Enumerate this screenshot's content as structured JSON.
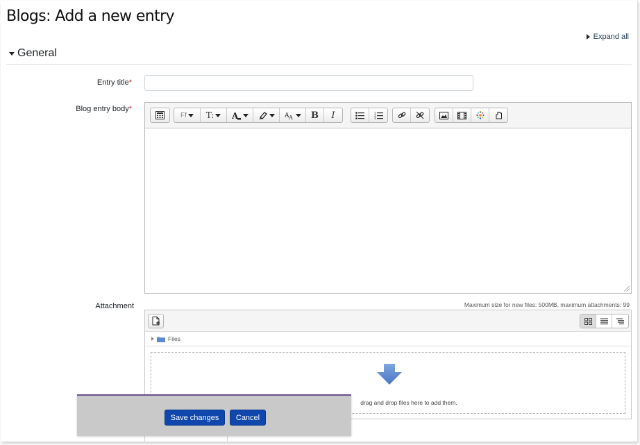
{
  "page": {
    "title": "Blogs: Add a new entry",
    "expand_all": "Expand all"
  },
  "section": {
    "title": "General"
  },
  "form": {
    "entry_title": {
      "label": "Entry title",
      "required_mark": "*",
      "value": ""
    },
    "body": {
      "label": "Blog entry body",
      "required_mark": "*",
      "value": ""
    },
    "attachment": {
      "label": "Attachment",
      "max_info": "Maximum size for new files: 500MB, maximum attachments: 99",
      "path_root": "Files",
      "drop_hint": "drag and drop files here to add them."
    }
  },
  "editor_toolbar": [
    {
      "group": "collapse",
      "items": [
        "show-more-buttons-icon"
      ]
    },
    {
      "group": "style",
      "items": [
        "font-family",
        "font-size",
        "font-color",
        "background-color",
        "text-direction",
        "bold",
        "italic"
      ]
    },
    {
      "group": "list",
      "items": [
        "unordered-list",
        "ordered-list"
      ]
    },
    {
      "group": "links",
      "items": [
        "link",
        "unlink"
      ]
    },
    {
      "group": "files",
      "items": [
        "image",
        "media",
        "h5p",
        "manage-files"
      ]
    }
  ],
  "editor_labels": {
    "font_family": "Ff",
    "font_size": "T:",
    "bold": "B",
    "italic": "I"
  },
  "buttons": {
    "save": "Save changes",
    "cancel": "Cancel"
  },
  "colors": {
    "primary": "#0f47ad",
    "required": "#c41e24",
    "footer_bar": "#c9c9c9",
    "drop_arrow": "#5b86c9"
  }
}
